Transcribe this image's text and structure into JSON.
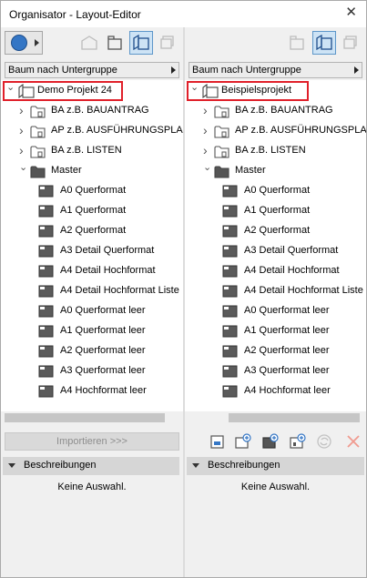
{
  "window": {
    "title": "Organisator - Layout-Editor",
    "close_glyph": "✕"
  },
  "left": {
    "dropdown": "Baum nach Untergruppe",
    "root": "Demo Projekt 24",
    "groups": [
      "BA z.B. BAUANTRAG",
      "AP z.B. AUSFÜHRUNGSPLANUNG",
      "BA z.B. LISTEN"
    ],
    "master": "Master",
    "layouts": [
      "A0 Querformat",
      "A1 Querformat",
      "A2 Querformat",
      "A3 Detail Querformat",
      "A4 Detail Hochformat",
      "A4 Detail Hochformat Liste",
      "A0 Querformat leer",
      "A1 Querformat leer",
      "A2 Querformat leer",
      "A3 Querformat leer",
      "A4 Hochformat leer"
    ],
    "import_button": "Importieren >>>",
    "section": "Beschreibungen",
    "no_selection": "Keine Auswahl."
  },
  "right": {
    "dropdown": "Baum nach Untergruppe",
    "root": "Beispielsprojekt",
    "groups": [
      "BA z.B. BAUANTRAG",
      "AP z.B. AUSFÜHRUNGSPLANUNG",
      "BA z.B. LISTEN"
    ],
    "master": "Master",
    "layouts": [
      "A0 Querformat",
      "A1 Querformat",
      "A2 Querformat",
      "A3 Detail Querformat",
      "A4 Detail Hochformat",
      "A4 Detail Hochformat Liste",
      "A0 Querformat leer",
      "A1 Querformat leer",
      "A2 Querformat leer",
      "A3 Querformat leer",
      "A4 Hochformat leer"
    ],
    "section": "Beschreibungen",
    "no_selection": "Keine Auswahl."
  },
  "icons": {
    "toolbar_left": [
      "project-map-icon",
      "view-map-icon",
      "layout-book-icon",
      "publisher-icon"
    ],
    "toolbar_right": [
      "layout-book-icon",
      "publisher-icon",
      "clone-icon"
    ],
    "bottom_right": [
      "new-layout-icon",
      "new-subset-icon",
      "new-master-icon",
      "new-folder-icon",
      "refresh-icon",
      "delete-icon"
    ]
  },
  "colors": {
    "highlight_border": "#e0202a",
    "active_tab": "#cde3f5",
    "accent": "#3476c5"
  }
}
